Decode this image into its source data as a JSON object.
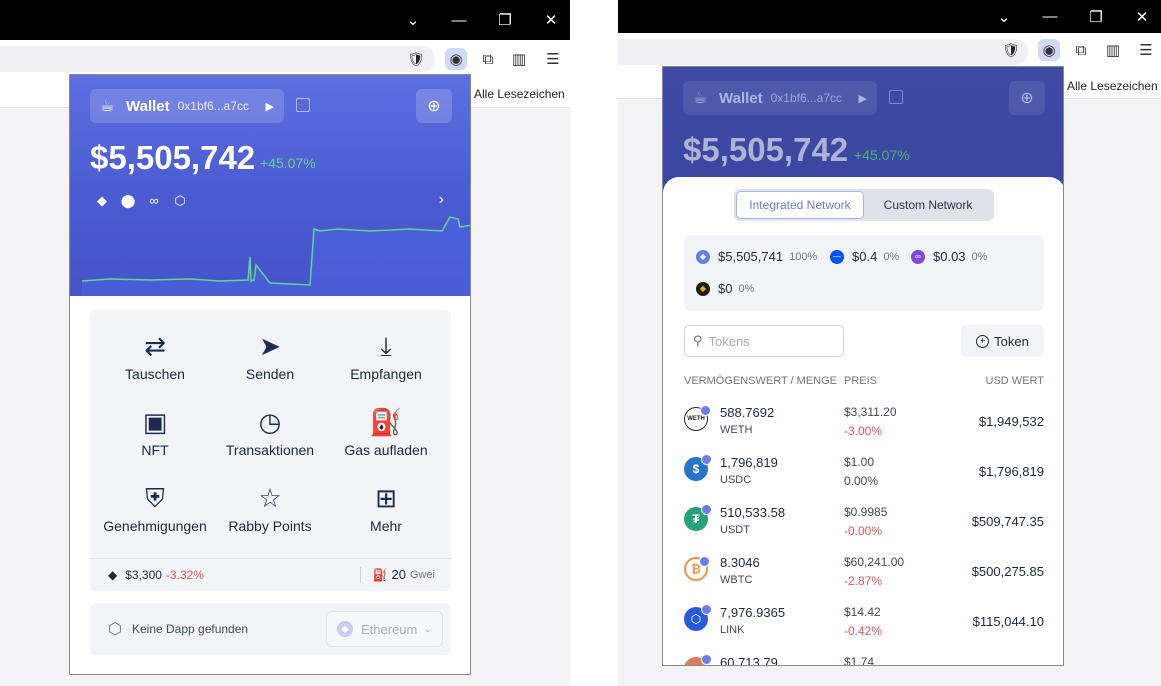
{
  "left": {
    "bookmarks_label": "Alle Lesezeichen",
    "popup": {
      "wallet_name": "Wallet",
      "wallet_address": "0x1bf6...a7cc",
      "balance": "$5,505,742",
      "change": "+45.07%",
      "actions": [
        {
          "label": "Tauschen",
          "icon": "⇄"
        },
        {
          "label": "Senden",
          "icon": "➤"
        },
        {
          "label": "Empfangen",
          "icon": "⤓"
        },
        {
          "label": "NFT",
          "icon": "▣"
        },
        {
          "label": "Transaktionen",
          "icon": "◷"
        },
        {
          "label": "Gas aufladen",
          "icon": "⛽"
        },
        {
          "label": "Genehmigungen",
          "icon": "⛨"
        },
        {
          "label": "Rabby Points",
          "icon": "☆"
        },
        {
          "label": "Mehr",
          "icon": "⊞"
        }
      ],
      "eth_price": "$3,300",
      "eth_change": "-3.32%",
      "gas_value": "20",
      "gas_unit": "Gwei",
      "dapp_text": "Keine Dapp gefunden",
      "network": "Ethereum"
    }
  },
  "right": {
    "bookmarks_label": "Alle Lesezeichen",
    "popup": {
      "wallet_name": "Wallet",
      "wallet_address": "0x1bf6...a7cc",
      "balance": "$5,505,742",
      "change": "+45.07%",
      "tabs": {
        "integrated": "Integrated Network",
        "custom": "Custom Network"
      },
      "distribution": [
        {
          "value": "$5,505,741",
          "pct": "100%",
          "color": "#627eea"
        },
        {
          "value": "$0.4",
          "pct": "0%",
          "color": "#0052ff"
        },
        {
          "value": "$0.03",
          "pct": "0%",
          "color": "#8247e5"
        },
        {
          "value": "$0",
          "pct": "0%",
          "color": "#1e1e1e"
        }
      ],
      "search_placeholder": "Tokens",
      "add_token_label": "Token",
      "table_headers": {
        "asset": "VERMÖGENSWERT / MENGE",
        "price": "PREIS",
        "usd": "USD WERT"
      },
      "tokens": [
        {
          "amount": "588.7692",
          "symbol": "WETH",
          "price": "$3,311.20",
          "change": "-3.00%",
          "usd": "$1,949,532",
          "icon_text": "WETH",
          "icon_color": "#ffffff"
        },
        {
          "amount": "1,796,819",
          "symbol": "USDC",
          "price": "$1.00",
          "change": "0.00%",
          "usd": "$1,796,819",
          "icon_text": "$",
          "icon_color": "#2775ca"
        },
        {
          "amount": "510,533.58",
          "symbol": "USDT",
          "price": "$0.9985",
          "change": "-0.00%",
          "usd": "$509,747.35",
          "icon_text": "₮",
          "icon_color": "#26a17b"
        },
        {
          "amount": "8.3046",
          "symbol": "WBTC",
          "price": "$60,241.00",
          "change": "-2.87%",
          "usd": "$500,275.85",
          "icon_text": "₿",
          "icon_color": "#f09242"
        },
        {
          "amount": "7,976.9365",
          "symbol": "LINK",
          "price": "$14.42",
          "change": "-0.42%",
          "usd": "$115,044.10",
          "icon_text": "⬡",
          "icon_color": "#2a5ada"
        },
        {
          "amount": "60,713.79",
          "symbol": "",
          "price": "$1.74",
          "change": "",
          "usd": "",
          "icon_text": "",
          "icon_color": "#e07c5a"
        }
      ]
    }
  }
}
